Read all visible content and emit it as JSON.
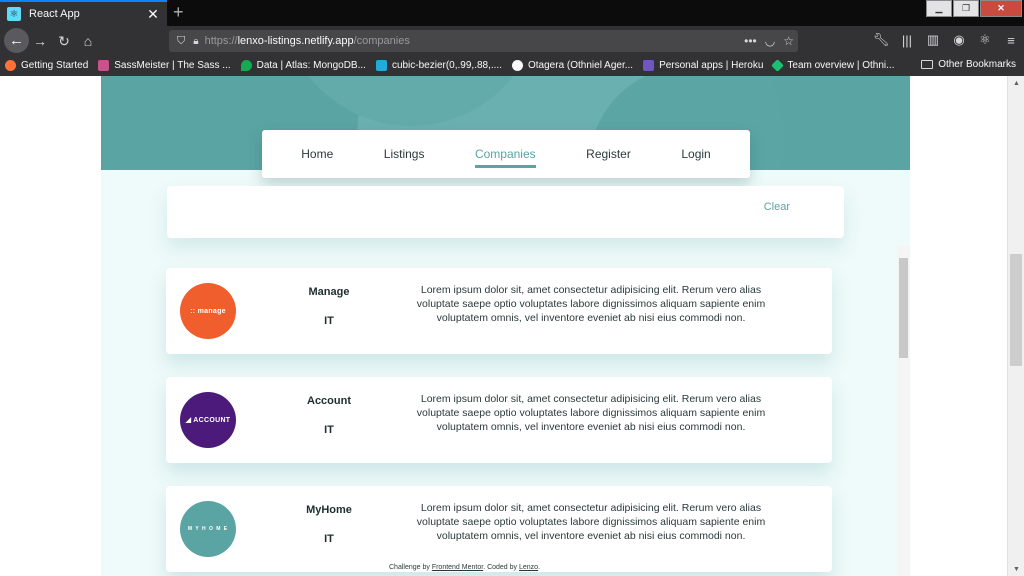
{
  "browser": {
    "tab_title": "React App",
    "tab_close": "✕",
    "new_tab": "+",
    "url_scheme": "https://",
    "url_host": "lenxo-listings.netlify.app",
    "url_path": "/companies",
    "bookmarks": [
      {
        "label": "Getting Started",
        "color": "#ff7139"
      },
      {
        "label": "SassMeister | The Sass ...",
        "color": "#c6538c"
      },
      {
        "label": "Data | Atlas: MongoDB...",
        "color": "#13aa52"
      },
      {
        "label": "cubic-bezier(0,.99,.88,....",
        "color": "#22aadd"
      },
      {
        "label": "Otagera (Othniel Ager...",
        "color": "#f9f9fa"
      },
      {
        "label": "Personal apps | Heroku",
        "color": "#7056bf"
      },
      {
        "label": "Team overview | Othni...",
        "color": "#1dbf73"
      }
    ],
    "other_bookmarks": "Other Bookmarks"
  },
  "nav": {
    "links": [
      "Home",
      "Listings",
      "Companies",
      "Register",
      "Login"
    ],
    "active_index": 2
  },
  "filter": {
    "clear_label": "Clear"
  },
  "companies": [
    {
      "name": "Manage",
      "category": "IT",
      "logo_text": ":: manage",
      "logo_color": "#f15e2e",
      "description": "Lorem ipsum dolor sit, amet consectetur adipisicing elit. Rerum vero alias voluptate saepe optio voluptates labore dignissimos aliquam sapiente enim voluptatem omnis, vel inventore eveniet ab nisi eius commodi non."
    },
    {
      "name": "Account",
      "category": "IT",
      "logo_text": "◢ ACCOUNT",
      "logo_color": "#4c1a7a",
      "description": "Lorem ipsum dolor sit, amet consectetur adipisicing elit. Rerum vero alias voluptate saepe optio voluptates labore dignissimos aliquam sapiente enim voluptatem omnis, vel inventore eveniet ab nisi eius commodi non."
    },
    {
      "name": "MyHome",
      "category": "IT",
      "logo_text": "M Y H O M E",
      "logo_color": "#5ba4a4",
      "description": "Lorem ipsum dolor sit, amet consectetur adipisicing elit. Rerum vero alias voluptate saepe optio voluptates labore dignissimos aliquam sapiente enim voluptatem omnis, vel inventore eveniet ab nisi eius commodi non."
    }
  ],
  "footer": {
    "prefix": "Challenge by ",
    "link1": "Frontend Mentor",
    "middle": ". Coded by ",
    "link2": "Lenzo",
    "suffix": "."
  },
  "colors": {
    "accent": "#5ba4a4",
    "page_bg": "#effafa"
  }
}
